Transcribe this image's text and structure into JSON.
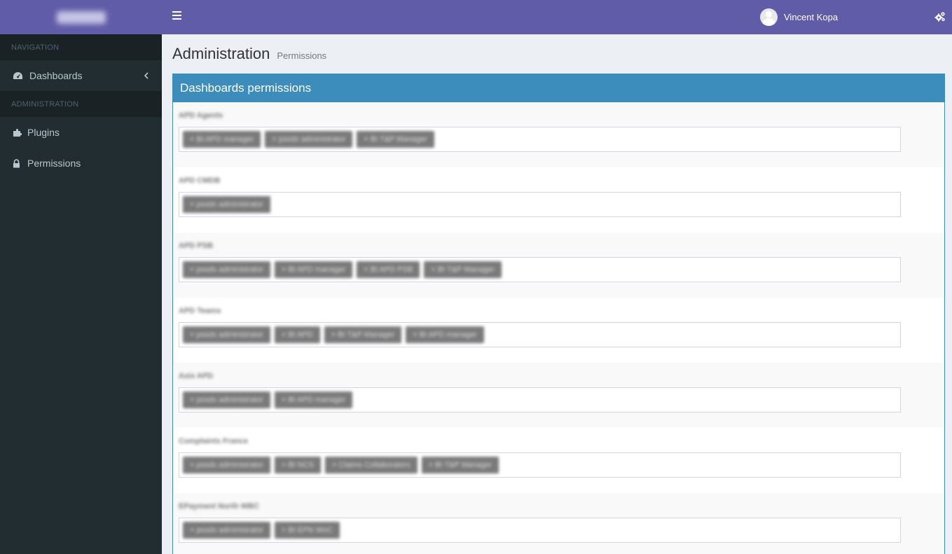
{
  "header": {
    "username": "Vincent Kopa"
  },
  "sidebar": {
    "sections": [
      {
        "label": "NAVIGATION"
      },
      {
        "label": "ADMINISTRATION"
      }
    ],
    "items": [
      {
        "label": "Dashboards"
      },
      {
        "label": "Plugins"
      },
      {
        "label": "Permissions"
      }
    ]
  },
  "page": {
    "title": "Administration",
    "subtitle": "Permissions"
  },
  "box": {
    "title": "Dashboards permissions"
  },
  "permissions": [
    {
      "name": "APD Agents",
      "tags": [
        "BI APD manager",
        "pssdx administrator",
        "BI T&P Manager"
      ]
    },
    {
      "name": "APD CMDB",
      "tags": [
        "pssdx administrator"
      ]
    },
    {
      "name": "APD PSB",
      "tags": [
        "pssdx administrator",
        "BI APD manager",
        "BI APD PSB",
        "BI T&P Manager"
      ]
    },
    {
      "name": "APD Teams",
      "tags": [
        "pssdx administrator",
        "BI APD",
        "BI T&P Manager",
        "BI APD manager"
      ]
    },
    {
      "name": "Axis APD",
      "tags": [
        "pssdx administrator",
        "BI APD manager"
      ]
    },
    {
      "name": "Complaints France",
      "tags": [
        "pssdx administrator",
        "BI NCS",
        "Claims Collaborators",
        "BI T&P Manager"
      ]
    },
    {
      "name": "EPayment North WBC",
      "tags": [
        "pssdx administrator",
        "BI EPN WoC"
      ]
    }
  ]
}
